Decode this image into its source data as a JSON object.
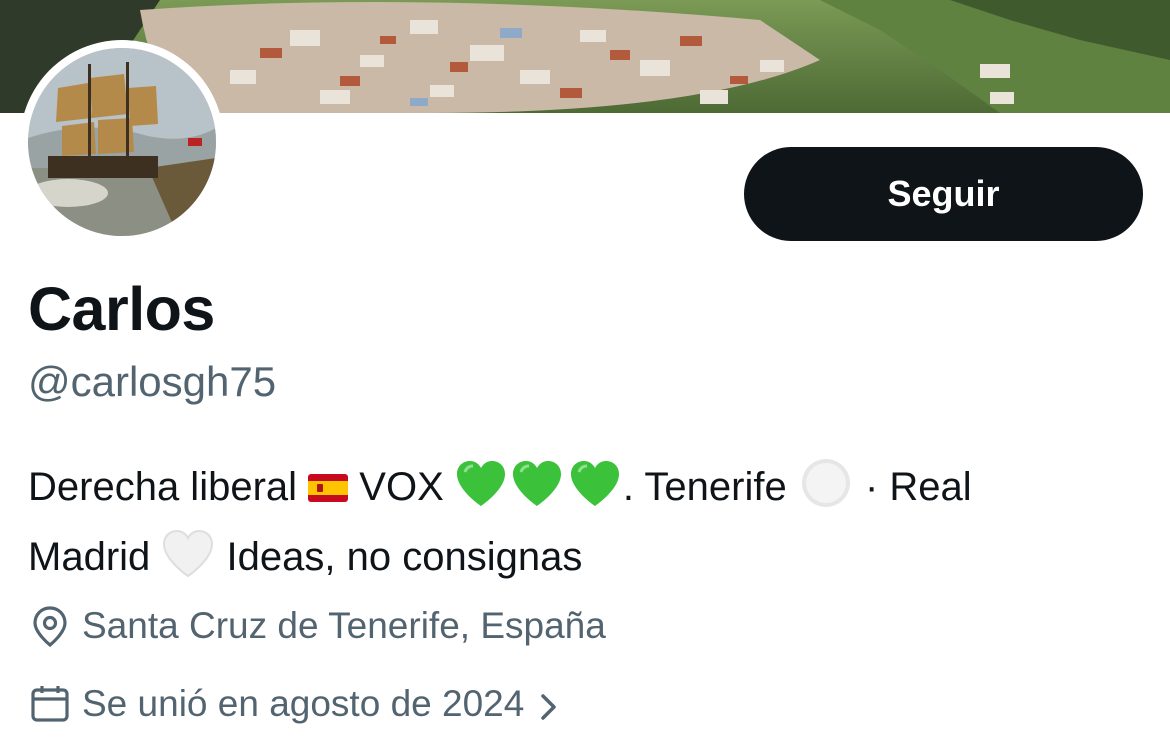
{
  "profile": {
    "display_name": "Carlos",
    "handle": "@carlosgh75",
    "follow_label": "Seguir",
    "bio": {
      "part1": "Derecha liberal",
      "part2": "VOX",
      "part3": ". Tenerife",
      "part4": "· Real",
      "part5": "Madrid",
      "part6": "Ideas, no consignas"
    },
    "location": "Santa Cruz de Tenerife, España",
    "joined": "Se unió en agosto de 2024"
  },
  "icons": {
    "location": "location-pin-icon",
    "joined": "calendar-icon",
    "chevron": "chevron-right-icon"
  },
  "colors": {
    "text_primary": "#0f1419",
    "text_secondary": "#536471",
    "button_bg": "#0f1419",
    "button_text": "#ffffff",
    "heart_green": "#3cc13b"
  }
}
